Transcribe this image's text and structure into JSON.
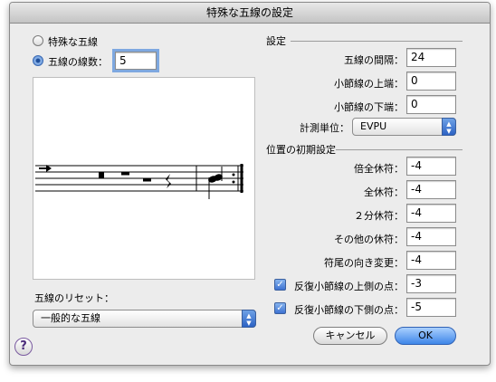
{
  "window": {
    "title": "特殊な五線の設定"
  },
  "staff_type": {
    "option_special": "特殊な五線",
    "option_lines": "五線の線数：",
    "lines_value": "5"
  },
  "reset": {
    "label": "五線のリセット：",
    "selected": "一般的な五線"
  },
  "settings": {
    "header": "設定",
    "spacing_label": "五線の間隔：",
    "spacing_value": "24",
    "top_label": "小節線の上端：",
    "top_value": "0",
    "bottom_label": "小節線の下端：",
    "bottom_value": "0",
    "units_label": "計測単位：",
    "units_selected": "EVPU"
  },
  "initial_position": {
    "header": "位置の初期設定",
    "double_whole_rest_label": "倍全休符：",
    "double_whole_rest_value": "-4",
    "whole_rest_label": "全休符：",
    "whole_rest_value": "-4",
    "half_rest_label": "２分休符：",
    "half_rest_value": "-4",
    "other_rest_label": "その他の休符：",
    "other_rest_value": "-4",
    "stem_flip_label": "符尾の向き変更：",
    "stem_flip_value": "-4",
    "repeat_upper_label": "反復小節線の上側の点：",
    "repeat_upper_value": "-3",
    "repeat_upper_checked": true,
    "repeat_lower_label": "反復小節線の下側の点：",
    "repeat_lower_value": "-5",
    "repeat_lower_checked": true
  },
  "buttons": {
    "cancel": "キャンセル",
    "ok": "OK",
    "help": "?"
  },
  "icons": {
    "radio_selected": "radio-selected-icon",
    "checkbox_checked": "checkmark-icon",
    "popup_arrows": "up-down-arrows-icon"
  },
  "colors": {
    "accent": "#3e86e8",
    "window_bg": "#ececec"
  }
}
